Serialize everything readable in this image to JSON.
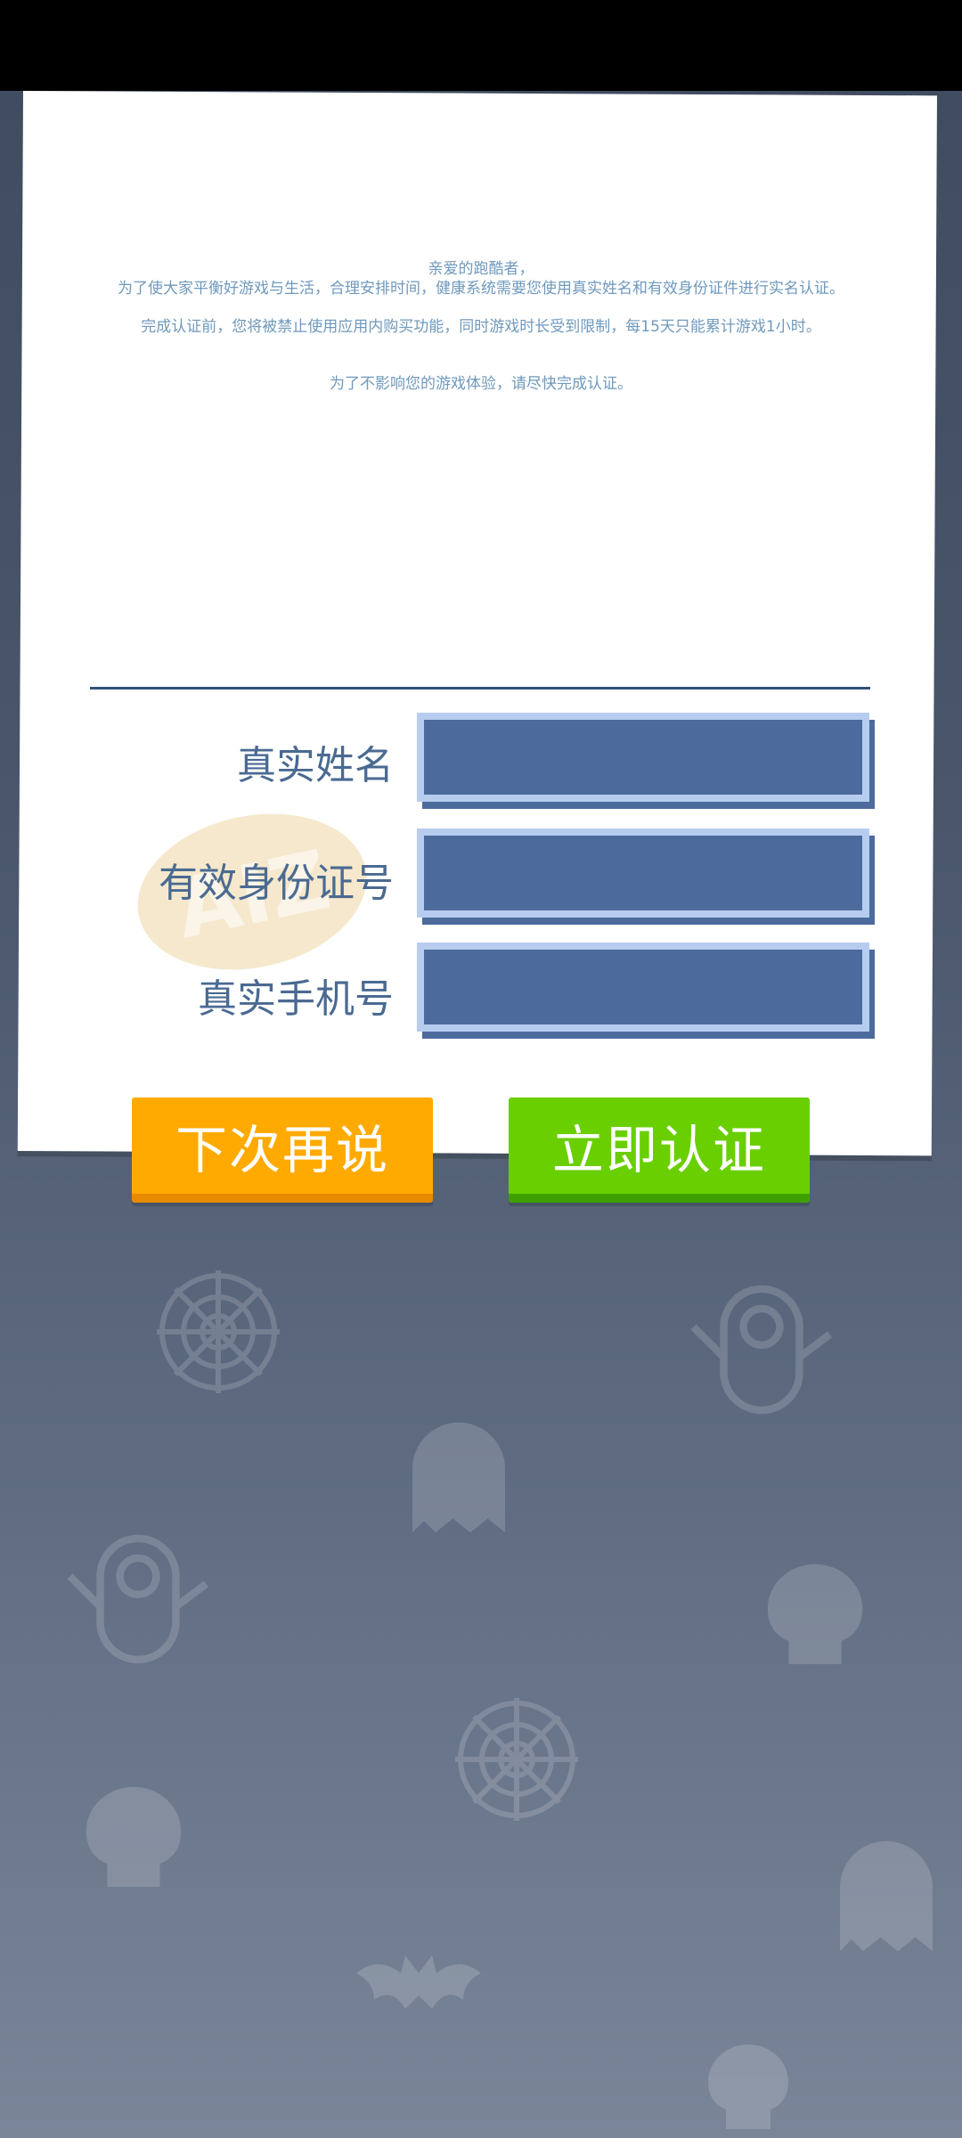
{
  "notice": {
    "greeting": "亲爱的跑酷者，",
    "line1": "为了使大家平衡好游戏与生活，合理安排时间，健康系统需要您使用真实姓名和有效身份证件进行实名认证。",
    "line2": "完成认证前，您将被禁止使用应用内购买功能，同时游戏时长受到限制，每15天只能累计游戏1小时。",
    "line3": "为了不影响您的游戏体验，请尽快完成认证。"
  },
  "form": {
    "name_label": "真实姓名",
    "id_label": "有效身份证号",
    "phone_label": "真实手机号",
    "name_value": "",
    "id_value": "",
    "phone_value": ""
  },
  "buttons": {
    "later": "下次再说",
    "verify": "立即认证"
  },
  "colors": {
    "later_button": "#ffaa00",
    "verify_button": "#69cf00",
    "field_fill": "#4d6a9d",
    "notice_text": "#6f99bd"
  }
}
